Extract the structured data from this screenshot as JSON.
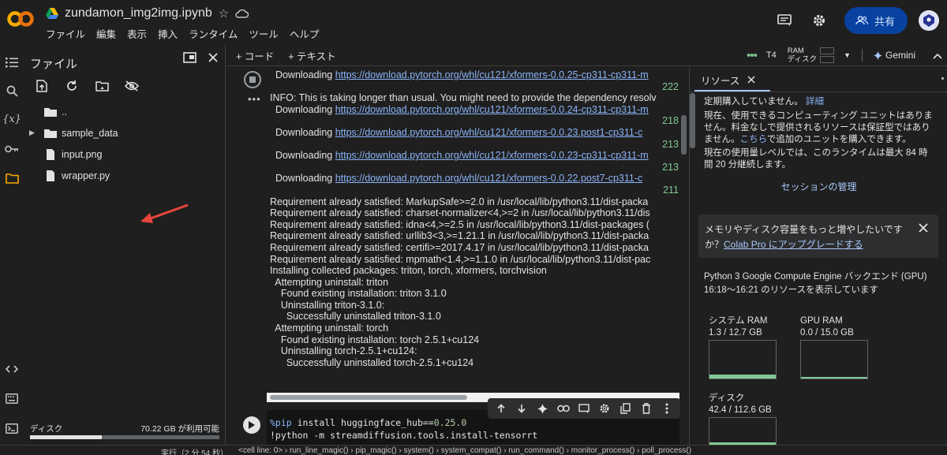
{
  "header": {
    "notebook_title": "zundamon_img2img.ipynb",
    "menu": [
      "ファイル",
      "編集",
      "表示",
      "挿入",
      "ランタイム",
      "ツール",
      "ヘルプ"
    ],
    "share_label": "共有"
  },
  "files_panel": {
    "title": "ファイル",
    "items": [
      {
        "name": "..",
        "type": "folder"
      },
      {
        "name": "sample_data",
        "type": "folder"
      },
      {
        "name": "input.png",
        "type": "file"
      },
      {
        "name": "wrapper.py",
        "type": "file"
      }
    ],
    "disk_label": "ディスク",
    "disk_free": "70.22 GB が利用可能",
    "disk_used_fraction": 0.38
  },
  "toolbar": {
    "add_code": "+ コード",
    "add_text": "+ テキスト",
    "runtime": "T4",
    "ram_label": "RAM",
    "disk_label": "ディスク",
    "gemini": "Gemini"
  },
  "output": {
    "lines": [
      {
        "pre": "  Downloading ",
        "link": "https://download.pytorch.org/whl/cu121/xformers-0.0.25-cp311-cp311-m"
      },
      {
        "prog": "222"
      },
      {
        "text": "INFO: This is taking longer than usual. You might need to provide the dependency resolv"
      },
      {
        "pre": "  Downloading ",
        "link": "https://download.pytorch.org/whl/cu121/xformers-0.0.24-cp311-cp311-m"
      },
      {
        "prog": "218"
      },
      {
        "pre": "  Downloading ",
        "link": "https://download.pytorch.org/whl/cu121/xformers-0.0.23.post1-cp311-c"
      },
      {
        "prog": "213"
      },
      {
        "pre": "  Downloading ",
        "link": "https://download.pytorch.org/whl/cu121/xformers-0.0.23-cp311-cp311-m"
      },
      {
        "prog": "213"
      },
      {
        "pre": "  Downloading ",
        "link": "https://download.pytorch.org/whl/cu121/xformers-0.0.22.post7-cp311-c"
      },
      {
        "prog": "211"
      },
      {
        "text": "Requirement already satisfied: MarkupSafe>=2.0 in /usr/local/lib/python3.11/dist-packa"
      },
      {
        "text": "Requirement already satisfied: charset-normalizer<4,>=2 in /usr/local/lib/python3.11/dis"
      },
      {
        "text": "Requirement already satisfied: idna<4,>=2.5 in /usr/local/lib/python3.11/dist-packages ("
      },
      {
        "text": "Requirement already satisfied: urllib3<3,>=1.21.1 in /usr/local/lib/python3.11/dist-packa"
      },
      {
        "text": "Requirement already satisfied: certifi>=2017.4.17 in /usr/local/lib/python3.11/dist-packa"
      },
      {
        "text": "Requirement already satisfied: mpmath<1.4,>=1.1.0 in /usr/local/lib/python3.11/dist-pac"
      },
      {
        "text": "Installing collected packages: triton, torch, xformers, torchvision"
      },
      {
        "text": "  Attempting uninstall: triton"
      },
      {
        "text": "    Found existing installation: triton 3.1.0"
      },
      {
        "text": "    Uninstalling triton-3.1.0:"
      },
      {
        "text": "      Successfully uninstalled triton-3.1.0"
      },
      {
        "text": "  Attempting uninstall: torch"
      },
      {
        "text": "    Found existing installation: torch 2.5.1+cu124"
      },
      {
        "text": "    Uninstalling torch-2.5.1+cu124:"
      },
      {
        "text": "      Successfully uninstalled torch-2.5.1+cu124"
      }
    ]
  },
  "code_cell": {
    "line1_magic": "%pip",
    "line1_rest": " install huggingface_hub==",
    "line1_version": "0.25.0",
    "line2": "!python -m streamdiffusion.tools.install-tensorrt"
  },
  "resources": {
    "tab_label": "リソース",
    "p1_text": "定期購入していません。",
    "p1_link": "詳細",
    "p2_a": "現在、使用できるコンピューティング ユニットはありません。料金なしで提供されるリソースは保証型ではありません。",
    "p2_link": "こちら",
    "p2_b": "で追加のユニットを購入できます。",
    "p3": "現在の使用量レベルでは、このランタイムは最大 84 時間 20 分継続します。",
    "manage_sessions": "セッションの管理",
    "promo_a": "メモリやディスク容量をもっと増やしたいです か？",
    "promo_link": "Colab Pro にアップグレードする",
    "backend_line1": "Python 3 Google Compute Engine バックエンド (GPU)",
    "backend_line2": "16:18〜16:21 のリソースを表示しています",
    "system_ram_label": "システム RAM",
    "system_ram_value": "1.3 / 12.7 GB",
    "system_ram_fraction": 0.1,
    "gpu_ram_label": "GPU RAM",
    "gpu_ram_value": "0.0 / 15.0 GB",
    "gpu_ram_fraction": 0.0,
    "disk_label": "ディスク",
    "disk_value": "42.4 / 112.6 GB",
    "disk_fraction": 0.38
  },
  "status_bar": {
    "left": "実行（2 分 54 秒）",
    "trace": "<cell line: 0> › run_line_magic() › pip_magic() › system() › system_compat() › run_command() › monitor_process() › poll_process()"
  }
}
